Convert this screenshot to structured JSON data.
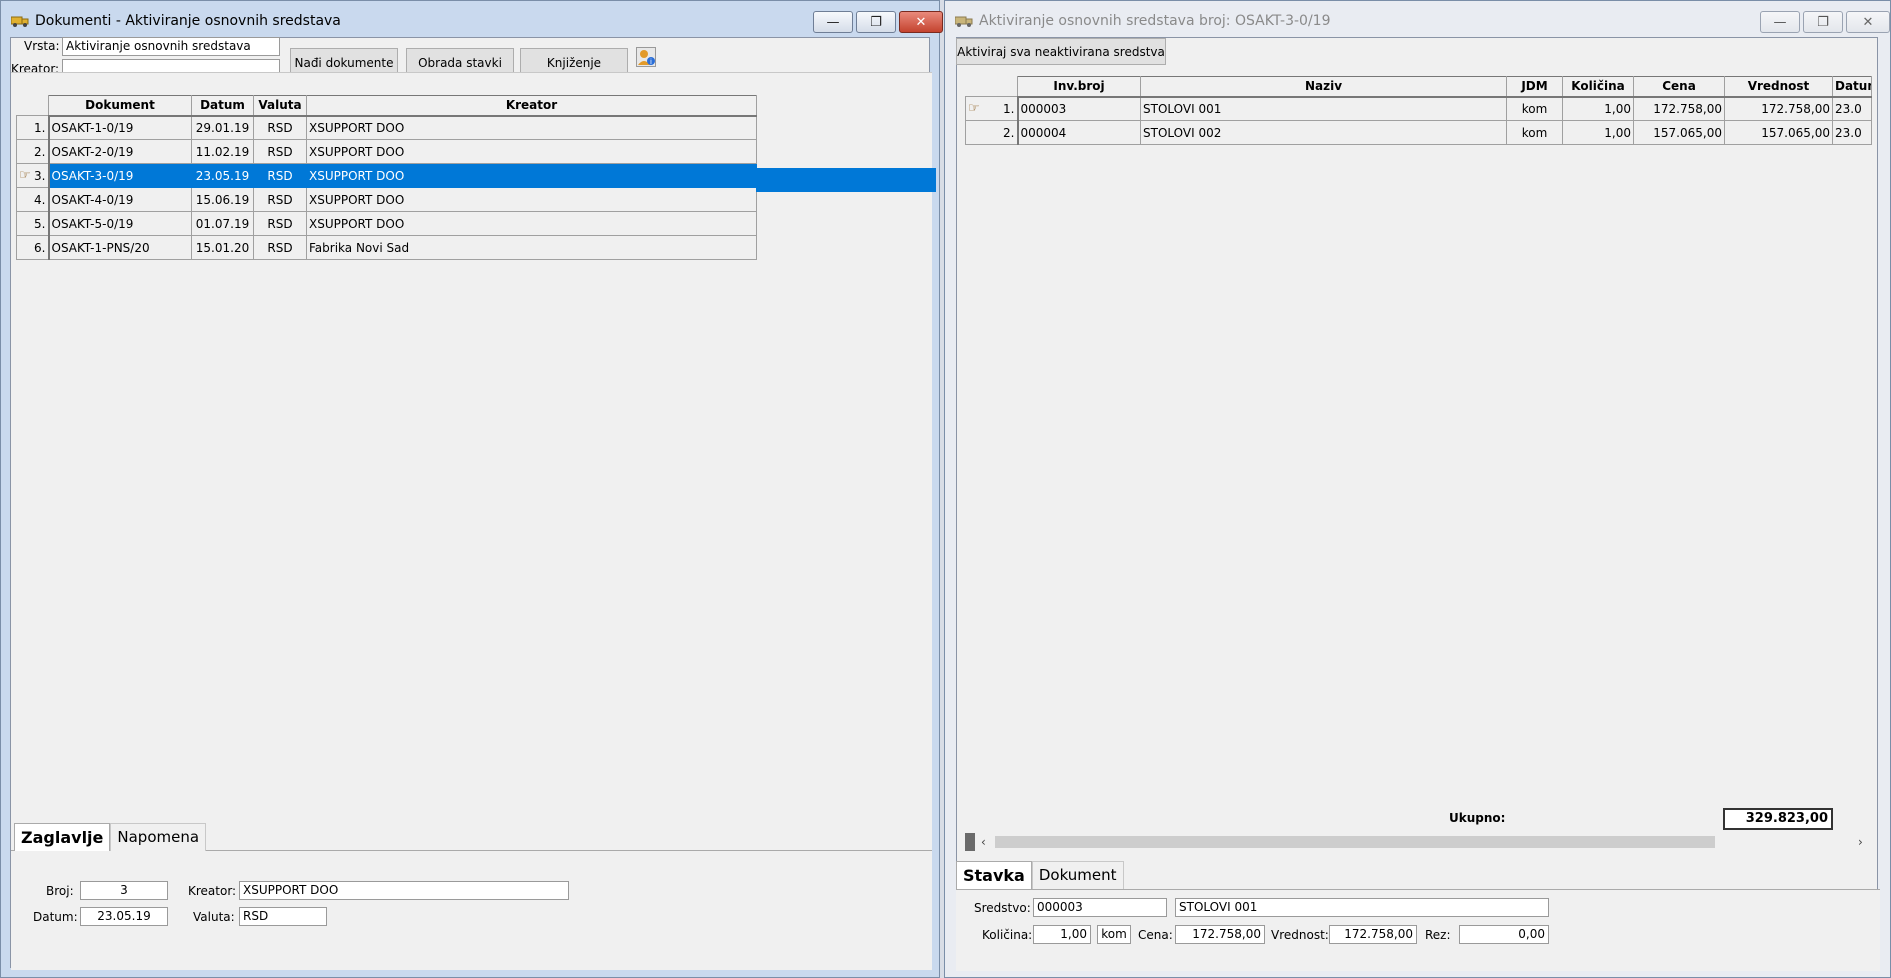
{
  "left": {
    "title": "Dokumenti - Aktiviranje osnovnih sredstava",
    "vrsta_label": "Vrsta:",
    "vrsta_value": "Aktiviranje osnovnih sredstava",
    "kreator_label": "Kreator:",
    "kreator_value": "",
    "btn_find": "Nađi dokumente",
    "btn_obrada": "Obrada stavki",
    "btn_knjizenje": "Knjiženje",
    "columns": [
      "Dokument",
      "Datum",
      "Valuta",
      "Kreator"
    ],
    "rows": [
      {
        "n": "1.",
        "doc": "OSAKT-1-0/19",
        "date": "29.01.19",
        "cur": "RSD",
        "kreator": "XSUPPORT DOO"
      },
      {
        "n": "2.",
        "doc": "OSAKT-2-0/19",
        "date": "11.02.19",
        "cur": "RSD",
        "kreator": "XSUPPORT DOO"
      },
      {
        "n": "3.",
        "doc": "OSAKT-3-0/19",
        "date": "23.05.19",
        "cur": "RSD",
        "kreator": "XSUPPORT DOO"
      },
      {
        "n": "4.",
        "doc": "OSAKT-4-0/19",
        "date": "15.06.19",
        "cur": "RSD",
        "kreator": "XSUPPORT DOO"
      },
      {
        "n": "5.",
        "doc": "OSAKT-5-0/19",
        "date": "01.07.19",
        "cur": "RSD",
        "kreator": "XSUPPORT DOO"
      },
      {
        "n": "6.",
        "doc": "OSAKT-1-PNS/20",
        "date": "15.01.20",
        "cur": "RSD",
        "kreator": "Fabrika Novi Sad"
      }
    ],
    "tabs": [
      "Zaglavlje",
      "Napomena"
    ],
    "broj_label": "Broj:",
    "broj_value": "3",
    "datum_label": "Datum:",
    "datum_value": "23.05.19",
    "kreator2_label": "Kreator:",
    "kreator2_value": "XSUPPORT DOO",
    "valuta_label": "Valuta:",
    "valuta_value": "RSD"
  },
  "right": {
    "title": "Aktiviranje osnovnih sredstava broj: OSAKT-3-0/19",
    "btn_activate": "Aktiviraj sva neaktivirana sredstva",
    "columns": [
      "Inv.broj",
      "Naziv",
      "JDM",
      "Količina",
      "Cena",
      "Vrednost",
      "Datum"
    ],
    "rows": [
      {
        "n": "1.",
        "inv": "000003",
        "naziv": "STOLOVI 001",
        "jdm": "kom",
        "kol": "1,00",
        "cena": "172.758,00",
        "vred": "172.758,00",
        "dat": "23.0"
      },
      {
        "n": "2.",
        "inv": "000004",
        "naziv": "STOLOVI 002",
        "jdm": "kom",
        "kol": "1,00",
        "cena": "157.065,00",
        "vred": "157.065,00",
        "dat": "23.0"
      }
    ],
    "ukupno_label": "Ukupno:",
    "ukupno_value": "329.823,00",
    "tabs": [
      "Stavka",
      "Dokument"
    ],
    "sredstvo_label": "Sredstvo:",
    "sredstvo_code": "000003",
    "sredstvo_name": "STOLOVI 001",
    "kolicina_label": "Količina:",
    "kolicina_value": "1,00",
    "jdm_value": "kom",
    "cena_label": "Cena:",
    "cena_value": "172.758,00",
    "vrednost_label": "Vrednost:",
    "vrednost_value": "172.758,00",
    "rez_label": "Rez:",
    "rez_value": "0,00"
  }
}
